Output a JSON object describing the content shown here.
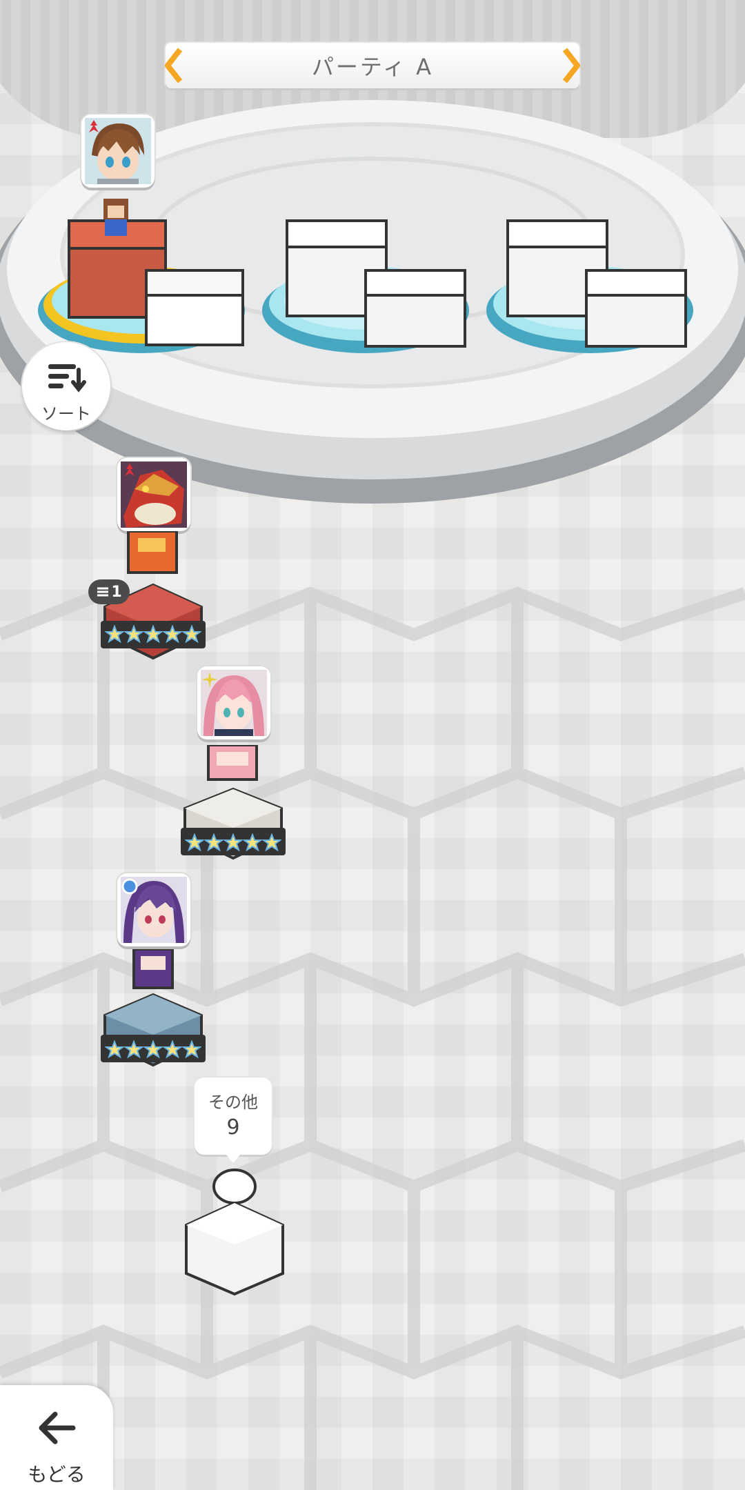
{
  "party": {
    "title": "パーティ A"
  },
  "sort": {
    "label": "ソート",
    "icon": "sort-icon"
  },
  "members": [
    {
      "slot": "1",
      "rarity_stars": 0,
      "attribute": "fire",
      "color": "#d8313a"
    },
    {
      "slot": "2",
      "rarity_stars": 5,
      "attribute": "fire",
      "color": "#d8313a",
      "count_badge": "1"
    },
    {
      "slot": "3",
      "rarity_stars": 5,
      "attribute": "light",
      "color": "#e7cf37"
    },
    {
      "slot": "4",
      "rarity_stars": 5,
      "attribute": "water",
      "color": "#4b8fe0"
    }
  ],
  "others": {
    "label": "その他",
    "count": "9"
  },
  "back": {
    "label": "もどる",
    "icon": "arrow-left-icon"
  },
  "colors": {
    "accent": "#f5a623",
    "stage_water": "#9fe2ee",
    "active_slot": "#f4c520"
  }
}
